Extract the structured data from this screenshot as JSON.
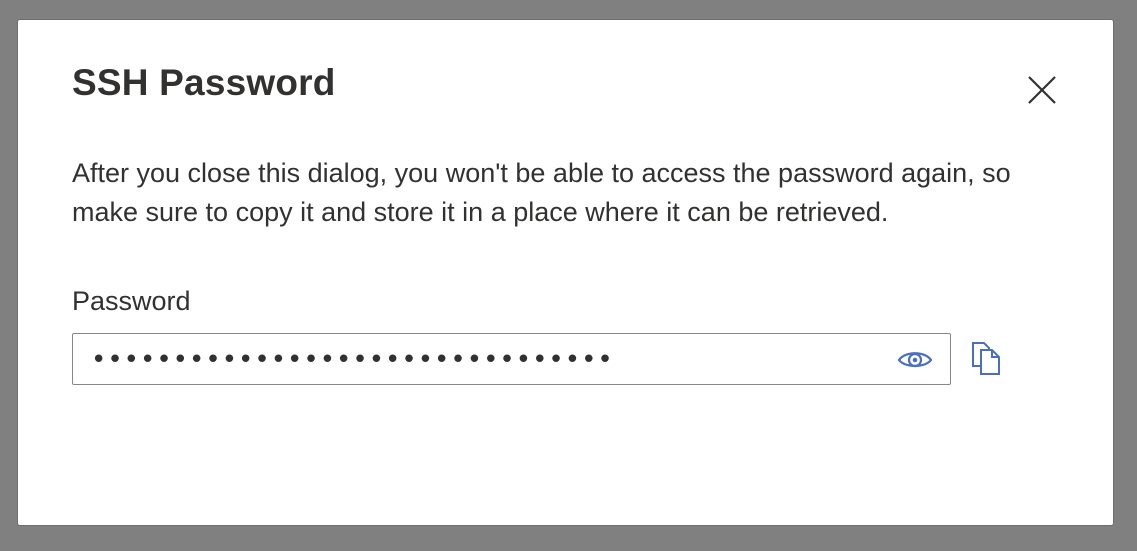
{
  "dialog": {
    "title": "SSH Password",
    "message": "After you close this dialog, you won't be able to access the password again, so make sure to copy it and store it in a place where it can be retrieved.",
    "close_icon": "close-icon"
  },
  "password_field": {
    "label": "Password",
    "masked_value": "••••••••••••••••••••••••••••••••",
    "reveal_icon": "eye-icon",
    "copy_icon": "copy-icon"
  },
  "colors": {
    "overlay": "#808080",
    "dialog_bg": "#ffffff",
    "text": "#323130",
    "accent_icon": "#4a6fbf",
    "input_border": "#8a8886"
  }
}
